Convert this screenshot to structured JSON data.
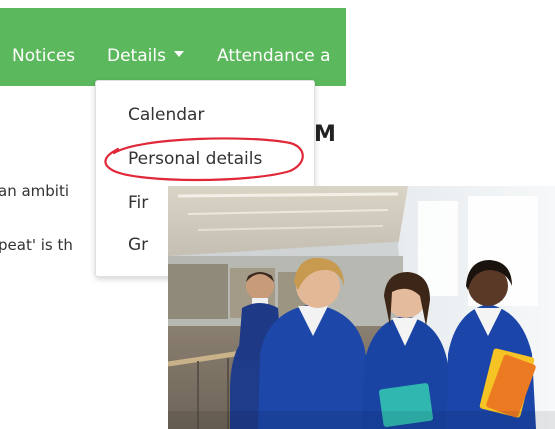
{
  "navbar": {
    "bg_color": "#5cb85c",
    "items": [
      {
        "label": "Notices"
      },
      {
        "label": "Details"
      },
      {
        "label": "Attendance a"
      }
    ]
  },
  "dropdown": {
    "items": [
      {
        "label": "Calendar"
      },
      {
        "label": "Personal details"
      },
      {
        "label": "Fir"
      },
      {
        "label": "Gr"
      }
    ]
  },
  "main": {
    "heading_fragment": "M",
    "text_line_1": "an ambiti",
    "text_line_2": "peat' is th"
  },
  "annotation": {
    "color": "#e0283a"
  }
}
